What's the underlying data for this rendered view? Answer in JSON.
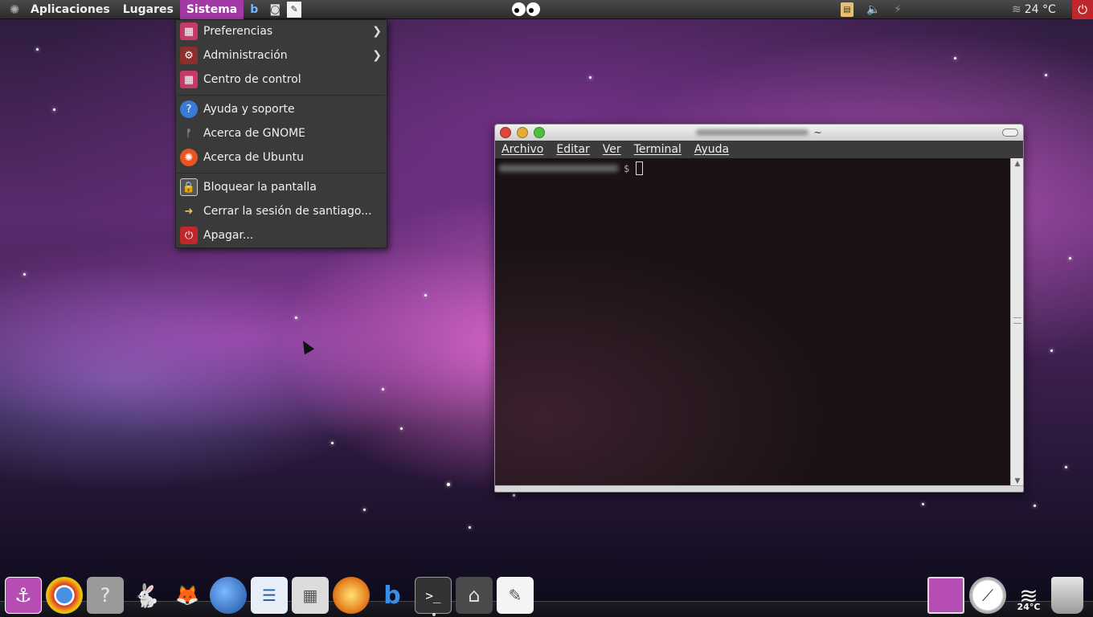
{
  "top_panel": {
    "menus": [
      "Aplicaciones",
      "Lugares",
      "Sistema"
    ],
    "active_menu": "Sistema",
    "launcher_icons": [
      "blogger-icon",
      "camera-icon",
      "text-editor-icon"
    ],
    "tray_icons": [
      "clipboard-icon",
      "volume-icon",
      "network-icon"
    ],
    "weather": {
      "icon": "wave-icon",
      "temperature": "24 °C"
    },
    "power_icon": "power-icon"
  },
  "system_menu": {
    "items": [
      {
        "label": "Preferencias",
        "icon": "preferences-icon",
        "submenu": true
      },
      {
        "label": "Administración",
        "icon": "administration-icon",
        "submenu": true
      },
      {
        "label": "Centro de control",
        "icon": "control-center-icon",
        "submenu": false
      },
      {
        "label": "Ayuda y soporte",
        "icon": "help-icon",
        "submenu": false
      },
      {
        "label": "Acerca de GNOME",
        "icon": "gnome-foot-icon",
        "submenu": false
      },
      {
        "label": "Acerca de Ubuntu",
        "icon": "ubuntu-icon",
        "submenu": false
      },
      {
        "label": "Bloquear la pantalla",
        "icon": "lock-screen-icon",
        "submenu": false
      },
      {
        "label": "Cerrar la sesión de santiago...",
        "icon": "logout-icon",
        "submenu": false
      },
      {
        "label": "Apagar...",
        "icon": "shutdown-icon",
        "submenu": false
      }
    ]
  },
  "terminal": {
    "title_suffix": "~",
    "menu": [
      "Archivo",
      "Editar",
      "Ver",
      "Terminal",
      "Ayuda"
    ],
    "prompt_symbol": "$"
  },
  "dock": {
    "left_icons": [
      "anchor-icon",
      "chrome-icon",
      "help-question-icon",
      "gnome-mascot-icon",
      "gimp-icon",
      "google-earth-icon",
      "text-document-icon",
      "calculator-icon",
      "burner-icon",
      "blogger-icon",
      "terminal-icon",
      "home-folder-icon",
      "notepad-icon"
    ],
    "right_icons": [
      "workspace-icon",
      "clock-icon",
      "weather-icon",
      "trash-icon"
    ],
    "weather_temperature": "24°C"
  },
  "colors": {
    "active_menu_bg": "#a339a7",
    "panel_bg": "#2c2c2c",
    "menu_bg": "#3a3a3a",
    "power_red": "#c0272d"
  }
}
